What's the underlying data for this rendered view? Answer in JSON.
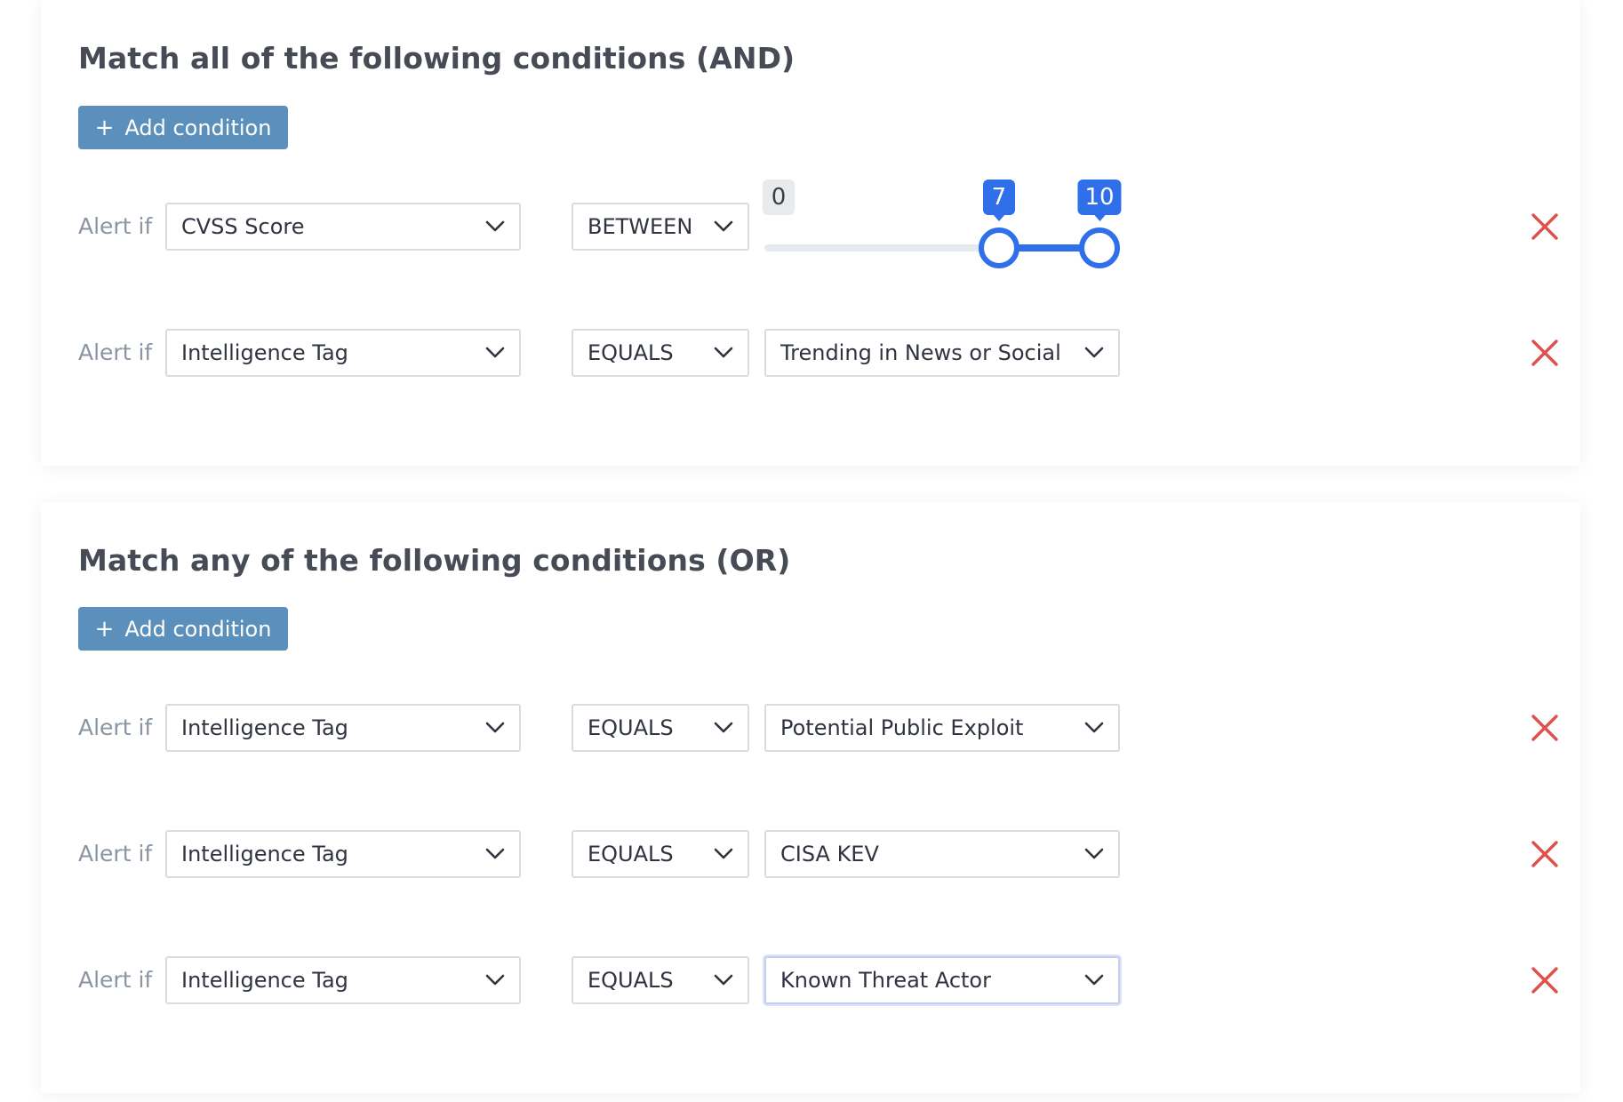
{
  "and_group": {
    "title": "Match all of the following conditions (AND)",
    "add_button": {
      "icon": "plus-icon",
      "label": "Add condition"
    },
    "conditions": [
      {
        "prefix": "Alert if",
        "field": "CVSS Score",
        "operator": "BETWEEN",
        "range": {
          "min": 0,
          "max": 10,
          "low": 7,
          "high": 10,
          "min_label": "0",
          "low_label": "7",
          "high_label": "10"
        }
      },
      {
        "prefix": "Alert if",
        "field": "Intelligence Tag",
        "operator": "EQUALS",
        "value": "Trending in News or Social"
      }
    ]
  },
  "or_group": {
    "title": "Match any of the following conditions (OR)",
    "add_button": {
      "icon": "plus-icon",
      "label": "Add condition"
    },
    "conditions": [
      {
        "prefix": "Alert if",
        "field": "Intelligence Tag",
        "operator": "EQUALS",
        "value": "Potential Public Exploit"
      },
      {
        "prefix": "Alert if",
        "field": "Intelligence Tag",
        "operator": "EQUALS",
        "value": "CISA KEV"
      },
      {
        "prefix": "Alert if",
        "field": "Intelligence Tag",
        "operator": "EQUALS",
        "value": "Known Threat Actor",
        "focused": true
      }
    ]
  },
  "icons": {
    "dropdown": "chevron-down-icon",
    "remove": "close-icon"
  },
  "colors": {
    "button": "#5b8fbc",
    "slider_accent": "#2f6fea",
    "remove": "#e0504a",
    "label": "#8a95a3",
    "title": "#464b55"
  }
}
